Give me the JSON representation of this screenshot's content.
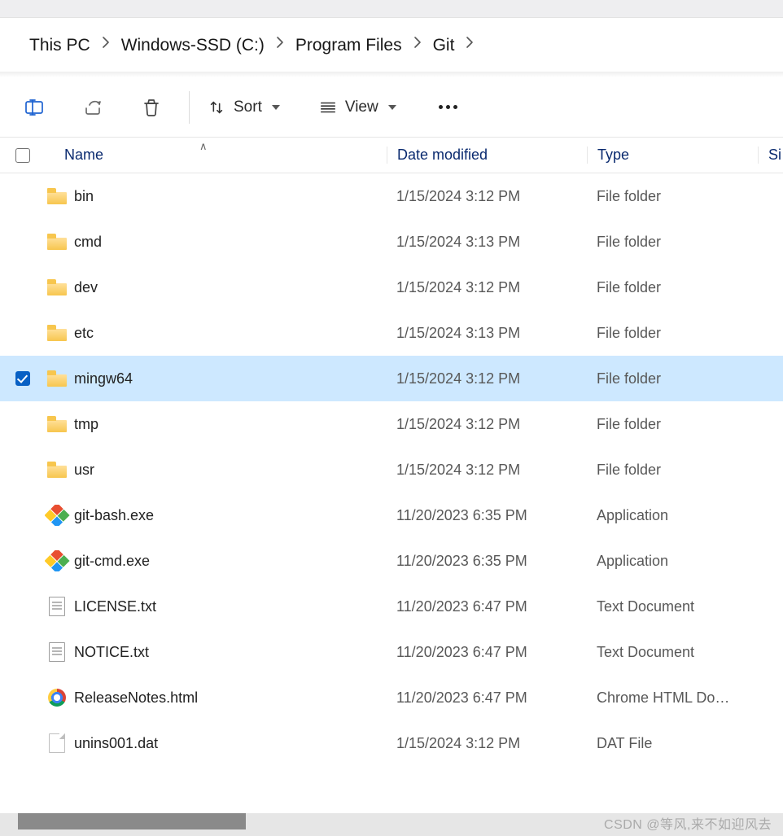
{
  "breadcrumb": [
    {
      "label": "This PC"
    },
    {
      "label": "Windows-SSD (C:)"
    },
    {
      "label": "Program Files"
    },
    {
      "label": "Git"
    }
  ],
  "toolbar": {
    "sort_label": "Sort",
    "view_label": "View"
  },
  "columns": {
    "name": "Name",
    "date": "Date modified",
    "type": "Type",
    "size": "Si"
  },
  "rows": [
    {
      "icon": "folder",
      "name": "bin",
      "date": "1/15/2024 3:12 PM",
      "type": "File folder",
      "selected": false
    },
    {
      "icon": "folder",
      "name": "cmd",
      "date": "1/15/2024 3:13 PM",
      "type": "File folder",
      "selected": false
    },
    {
      "icon": "folder",
      "name": "dev",
      "date": "1/15/2024 3:12 PM",
      "type": "File folder",
      "selected": false
    },
    {
      "icon": "folder",
      "name": "etc",
      "date": "1/15/2024 3:13 PM",
      "type": "File folder",
      "selected": false
    },
    {
      "icon": "folder",
      "name": "mingw64",
      "date": "1/15/2024 3:12 PM",
      "type": "File folder",
      "selected": true
    },
    {
      "icon": "folder",
      "name": "tmp",
      "date": "1/15/2024 3:12 PM",
      "type": "File folder",
      "selected": false
    },
    {
      "icon": "folder",
      "name": "usr",
      "date": "1/15/2024 3:12 PM",
      "type": "File folder",
      "selected": false
    },
    {
      "icon": "git",
      "name": "git-bash.exe",
      "date": "11/20/2023 6:35 PM",
      "type": "Application",
      "selected": false
    },
    {
      "icon": "git",
      "name": "git-cmd.exe",
      "date": "11/20/2023 6:35 PM",
      "type": "Application",
      "selected": false
    },
    {
      "icon": "txt",
      "name": "LICENSE.txt",
      "date": "11/20/2023 6:47 PM",
      "type": "Text Document",
      "selected": false
    },
    {
      "icon": "txt",
      "name": "NOTICE.txt",
      "date": "11/20/2023 6:47 PM",
      "type": "Text Document",
      "selected": false
    },
    {
      "icon": "chrome",
      "name": "ReleaseNotes.html",
      "date": "11/20/2023 6:47 PM",
      "type": "Chrome HTML Do…",
      "selected": false
    },
    {
      "icon": "blank",
      "name": "unins001.dat",
      "date": "1/15/2024 3:12 PM",
      "type": "DAT File",
      "selected": false
    }
  ],
  "watermark": "CSDN @等风,来不如迎风去"
}
